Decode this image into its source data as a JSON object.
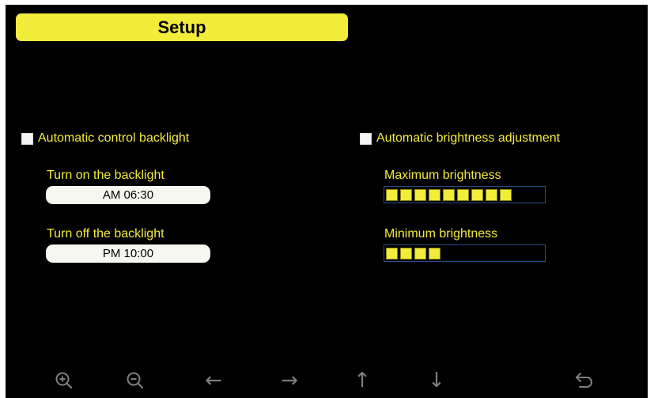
{
  "title": "Setup",
  "backlight": {
    "checkbox_label": "Automatic control backlight",
    "turn_on_label": "Turn on the backlight",
    "turn_on_value": "AM 06:30",
    "turn_off_label": "Turn off the backlight",
    "turn_off_value": "PM 10:00"
  },
  "brightness": {
    "checkbox_label": "Automatic brightness adjustment",
    "max_label": "Maximum brightness",
    "max_level": 9,
    "min_label": "Minimum brightness",
    "min_level": 4,
    "color": "#f2ec3a"
  },
  "toolbar": {
    "icons": [
      "zoom-in-icon",
      "zoom-out-icon",
      "arrow-left-icon",
      "arrow-right-icon",
      "arrow-up-icon",
      "arrow-down-icon",
      "return-icon"
    ]
  }
}
